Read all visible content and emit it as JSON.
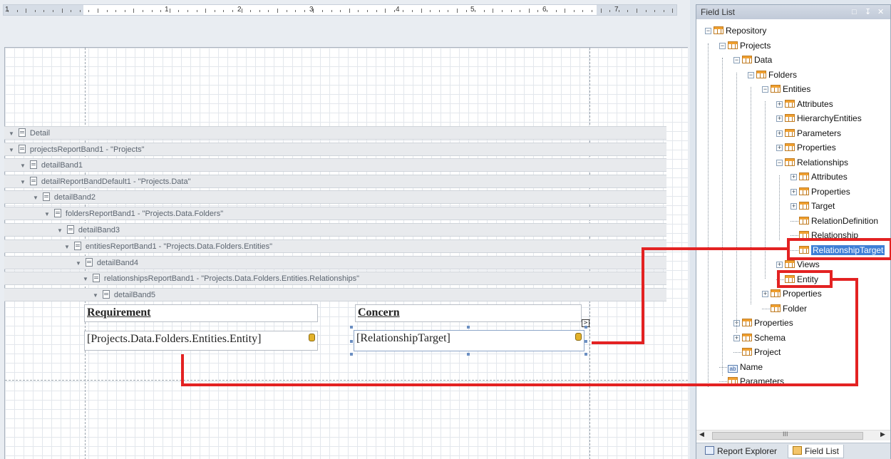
{
  "ruler": {
    "numbers": [
      "1",
      "2",
      "3",
      "4",
      "5",
      "6",
      "7"
    ],
    "first": "1"
  },
  "bands": [
    {
      "label": "Detail"
    },
    {
      "label": "projectsReportBand1 - \"Projects\""
    },
    {
      "label": "detailBand1"
    },
    {
      "label": "detailReportBandDefault1 - \"Projects.Data\""
    },
    {
      "label": "detailBand2"
    },
    {
      "label": "foldersReportBand1 - \"Projects.Data.Folders\""
    },
    {
      "label": "detailBand3"
    },
    {
      "label": "entitiesReportBand1 - \"Projects.Data.Folders.Entities\""
    },
    {
      "label": "detailBand4"
    },
    {
      "label": "relationshipsReportBand1 - \"Projects.Data.Folders.Entities.Relationships\""
    },
    {
      "label": "detailBand5"
    }
  ],
  "table": {
    "header1": "Requirement",
    "header2": "Concern",
    "cell1": "[Projects.Data.Folders.Entities.Entity]",
    "cell2": "[RelationshipTarget]"
  },
  "field_list": {
    "title": "Field List",
    "controls": [
      "□",
      "↧",
      "✕"
    ],
    "items": [
      {
        "label": "Repository"
      },
      {
        "label": "Projects"
      },
      {
        "label": "Data"
      },
      {
        "label": "Folders"
      },
      {
        "label": "Entities"
      },
      {
        "label": "Attributes"
      },
      {
        "label": "HierarchyEntities"
      },
      {
        "label": "Parameters"
      },
      {
        "label": "Properties"
      },
      {
        "label": "Relationships"
      },
      {
        "label": "Attributes"
      },
      {
        "label": "Properties"
      },
      {
        "label": "Target"
      },
      {
        "label": "RelationDefinition"
      },
      {
        "label": "Relationship"
      },
      {
        "label": "RelationshipTarget"
      },
      {
        "label": "Views"
      },
      {
        "label": "Entity"
      },
      {
        "label": "Properties"
      },
      {
        "label": "Folder"
      },
      {
        "label": "Properties"
      },
      {
        "label": "Schema"
      },
      {
        "label": "Project"
      },
      {
        "label": "Name"
      },
      {
        "label": "Parameters"
      }
    ],
    "scroll_mark": "III",
    "tabs": {
      "report_explorer": "Report Explorer",
      "field_list": "Field List"
    }
  },
  "colors": {
    "highlight": "#e32222",
    "selection": "#3f7fd6"
  }
}
